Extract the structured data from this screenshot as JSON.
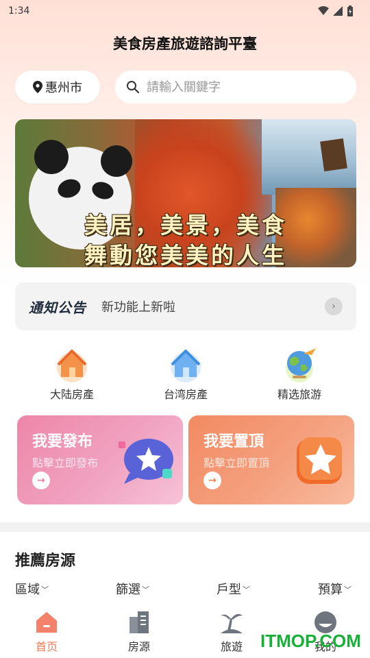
{
  "status_bar": {
    "time": "1:34"
  },
  "app": {
    "title": "美食房產旅遊諮詢平臺"
  },
  "location": {
    "city": "惠州市"
  },
  "search": {
    "placeholder": "請輸入關鍵字"
  },
  "banner": {
    "line1": "美居，美景，美食",
    "line2": "舞動您美美的人生"
  },
  "notice": {
    "brand": "通知公告",
    "text": "新功能上新啦"
  },
  "categories": [
    {
      "label": "大陆房產",
      "icon": "house-orange-icon"
    },
    {
      "label": "台湾房產",
      "icon": "house-blue-icon"
    },
    {
      "label": "精选旅游",
      "icon": "globe-plane-icon"
    }
  ],
  "promos": [
    {
      "title": "我要發布",
      "subtitle": "點擊立即發布",
      "icon": "chat-bubble-star-icon"
    },
    {
      "title": "我要置頂",
      "subtitle": "點擊立即置頂",
      "icon": "star-badge-icon"
    }
  ],
  "recommend": {
    "title": "推薦房源",
    "filters": [
      "區域",
      "篩選",
      "戶型",
      "預算"
    ]
  },
  "tabbar": [
    {
      "label": "首页",
      "icon": "home-icon",
      "active": true
    },
    {
      "label": "房源",
      "icon": "buildings-icon",
      "active": false
    },
    {
      "label": "旅遊",
      "icon": "palm-island-icon",
      "active": false
    },
    {
      "label": "我的",
      "icon": "profile-icon",
      "active": false
    }
  ],
  "watermark": "ITMOP.COM",
  "colors": {
    "accent": "#f07a5a",
    "publish": "#ee86a8",
    "top": "#f28a62",
    "watermark": "#19b03a"
  }
}
